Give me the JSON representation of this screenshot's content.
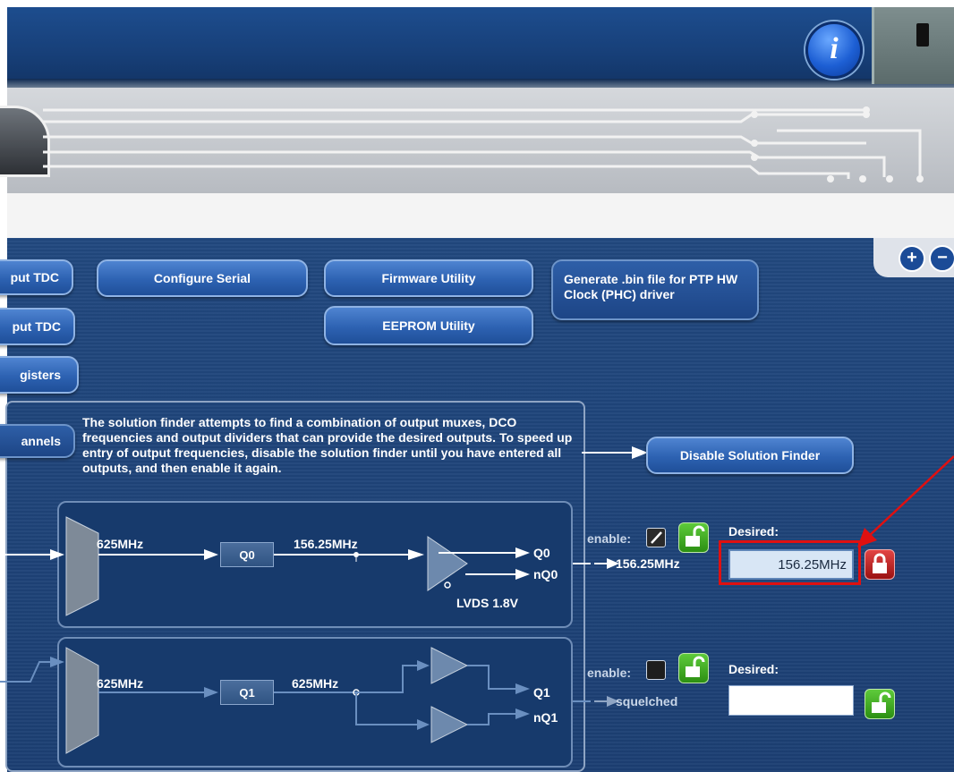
{
  "header": {
    "info_label": "i"
  },
  "zoom": {
    "in_label": "+",
    "out_label": "−"
  },
  "buttons": {
    "input_tdc_1": "put TDC",
    "input_tdc_2": "put TDC",
    "registers": "gisters",
    "configure_serial": "Configure Serial",
    "firmware_utility": "Firmware Utility",
    "eeprom_utility": "EEPROM Utility",
    "generate_bin": "Generate .bin file for PTP HW Clock (PHC) driver",
    "channels": "annels",
    "disable_solution_finder": "Disable Solution Finder"
  },
  "finder": {
    "description": "The solution finder attempts to find a combination of output muxes, DCO frequencies and output dividers that can provide the desired outputs. To speed up entry of output frequencies, disable the solution finder until you have entered all outputs, and then enable it again."
  },
  "channels": [
    {
      "mux_freq": "625MHz",
      "divider": "Q0",
      "div_freq": "156.25MHz",
      "out_p": "Q0",
      "out_n": "nQ0",
      "format": "LVDS 1.8V",
      "enable_label": "enable:",
      "enabled": true,
      "output_freq": "156.25MHz",
      "desired_label": "Desired:",
      "desired_value": "156.25MHz",
      "locked": true
    },
    {
      "mux_freq": "625MHz",
      "divider": "Q1",
      "div_freq": "625MHz",
      "out_p": "Q1",
      "out_n": "nQ1",
      "enable_label": "enable:",
      "enabled": false,
      "output_freq": "squelched",
      "desired_label": "Desired:",
      "desired_value": "",
      "locked": false
    }
  ],
  "colors": {
    "highlight": "#e01010",
    "panel_blue": "#1c3f73",
    "lock_green": "#3fae22",
    "lock_red": "#c42020"
  }
}
